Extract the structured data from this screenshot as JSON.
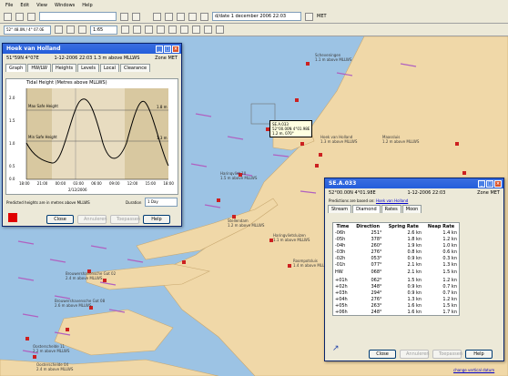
{
  "menu": [
    "File",
    "Edit",
    "View",
    "Windows",
    "Help"
  ],
  "toolbar": {
    "datetime": "d/date 1 december 2006 22:03",
    "timezone": "MET",
    "zoom": "1:65",
    "location_field": "52° 48.0N / 4° 07.0E"
  },
  "tide_window": {
    "title": "Hoek van Holland",
    "coords": "51°59N 4°07E",
    "datetime": "1-12-2006 22:03 1.3 m above MLLWS",
    "zone": "Zone MET",
    "tabs": [
      "Graph",
      "HW/LW",
      "Heights",
      "Levels",
      "Local",
      "Clearance"
    ],
    "graph_title": "Tidal Height (Metres above MLLWS)",
    "y_labels": [
      "2.0",
      "1.5",
      "1.0",
      "0.5",
      "0.0"
    ],
    "right_labels": [
      "1.8 m",
      "1.3 m"
    ],
    "max_safe": "Max Safe Height",
    "min_safe": "Min Safe Height",
    "x_labels": [
      "18:00",
      "21:00",
      "00:00",
      "03:00",
      "06:00",
      "09:00",
      "12:00",
      "15:00",
      "18:00"
    ],
    "date_label": "2/12/2006",
    "footer_note": "Predicted heights are in metres above MLLWS",
    "duration_label": "Duration",
    "duration_value": "1 Day",
    "buttons": {
      "close": "Close",
      "animate": "Annuleren",
      "apply": "Toepassen",
      "help": "Help"
    }
  },
  "stream_window": {
    "title": "SE.A.033",
    "coords": "52°00.00N 4°01.98E",
    "datetime": "1-12-2006 22:03",
    "zone": "Zone MET",
    "based_on_label": "Predictions are based on:",
    "based_on_link": "Hoek van Holland",
    "tabs": [
      "Stream",
      "Diamond",
      "Rates",
      "Moon"
    ],
    "columns": [
      "Time",
      "Direction",
      "Spring Rate",
      "Neap Rate"
    ],
    "rows": [
      [
        "-06h",
        "251°",
        "2.6 kn",
        "1.4 kn"
      ],
      [
        "-05h",
        "378°",
        "1.8 kn",
        "1.2 kn"
      ],
      [
        "-04h",
        "260°",
        "1.9 kn",
        "1.0 kn"
      ],
      [
        "-03h",
        "276°",
        "0.8 kn",
        "0.6 kn"
      ],
      [
        "-02h",
        "053°",
        "0.9 kn",
        "0.3 kn"
      ],
      [
        "-01h",
        "077°",
        "2.1 kn",
        "1.3 kn"
      ],
      [
        "HW",
        "068°",
        "2.1 kn",
        "1.5 kn"
      ],
      [
        "+01h",
        "062°",
        "1.5 kn",
        "1.2 kn"
      ],
      [
        "+02h",
        "348°",
        "0.9 kn",
        "0.7 kn"
      ],
      [
        "+03h",
        "294°",
        "0.9 kn",
        "0.7 kn"
      ],
      [
        "+04h",
        "276°",
        "1.3 kn",
        "1.2 kn"
      ],
      [
        "+05h",
        "263°",
        "1.6 kn",
        "1.5 kn"
      ],
      [
        "+06h",
        "248°",
        "1.6 kn",
        "1.7 kn"
      ]
    ],
    "buttons": {
      "close": "Close",
      "animate": "Annuleren",
      "apply": "Toepassen",
      "help": "Help"
    }
  },
  "map_popup": {
    "title": "SE.A.033",
    "line1": "52°00.00N 4°01.98E",
    "line2": "1.2 m, 070°"
  },
  "map_labels": [
    {
      "text": "Scheveningen",
      "sub": "1.1 m above MLLWS"
    },
    {
      "text": "Hoek van Holland",
      "sub": "1.3 m above MLLWS"
    },
    {
      "text": "Maassluis",
      "sub": "1.2 m above MLLWS"
    },
    {
      "text": "Harinqvliet 10",
      "sub": "1.5 m above MLLWS"
    },
    {
      "text": "Stellendam",
      "sub": "1.2 m above MLLWS"
    },
    {
      "text": "Haringvlietsluizen",
      "sub": "1.1 m above MLLWS"
    },
    {
      "text": "Roompotsluis",
      "sub": "1.4 m above MLLWS"
    },
    {
      "text": "Brouwershavensche Gat 02",
      "sub": "2.4 m above MLLWS"
    },
    {
      "text": "Brouwershavensche Gat 08",
      "sub": "2.6 m above MLLWS"
    },
    {
      "text": "Oosterschelde 11",
      "sub": "2.2 m above MLLWS"
    },
    {
      "text": "Oosterschelde 04",
      "sub": "2.4 m above MLLWS"
    }
  ],
  "status_link": "change vertical datum",
  "colors": {
    "sea": "#9cc3e4",
    "land": "#f0d8a8",
    "arrow": "#b060c0",
    "marker": "#cc2020"
  }
}
